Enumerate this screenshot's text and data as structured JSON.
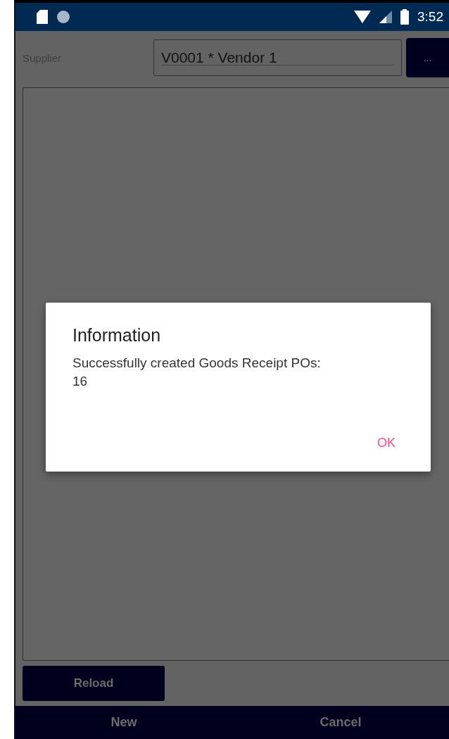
{
  "status_bar": {
    "time": "3:52"
  },
  "supplier": {
    "label": "Supplier",
    "value": "V0001 * Vendor 1",
    "browse_button": "..."
  },
  "reload_button": "Reload",
  "bottom_bar": {
    "buttons": [
      "New",
      "Cancel"
    ]
  },
  "dialog": {
    "title": "Information",
    "message": "Successfully created Goods Receipt POs:\n16",
    "buttons": [
      "OK"
    ]
  }
}
